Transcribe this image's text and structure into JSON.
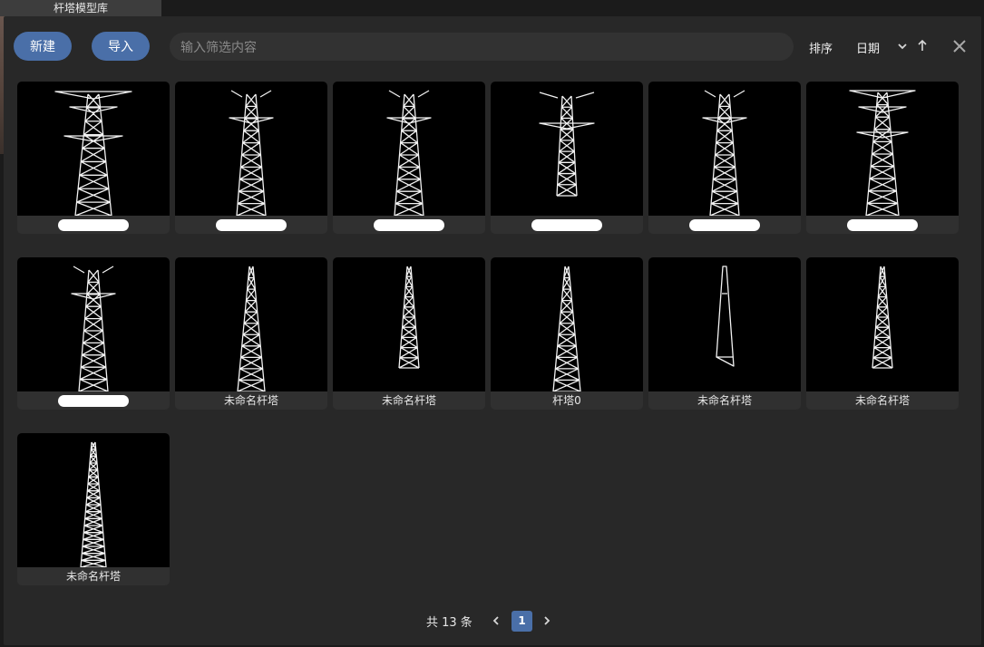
{
  "window": {
    "title": "杆塔模型库"
  },
  "toolbar": {
    "new_label": "新建",
    "import_label": "导入",
    "search_placeholder": "输入筛选内容",
    "sort_label": "排序",
    "sort_field": "日期",
    "chevron_icon": "chevron-down-icon",
    "direction_icon": "arrow-up-icon",
    "close_icon": "close-icon"
  },
  "accent_color": "#4a6fa8",
  "models": [
    {
      "label": "",
      "type": "double-crossarm",
      "redacted": true
    },
    {
      "label": "",
      "type": "cup-head",
      "redacted": true
    },
    {
      "label": "",
      "type": "cup-head",
      "redacted": true
    },
    {
      "label": "",
      "type": "cup-head-short",
      "redacted": true
    },
    {
      "label": "",
      "type": "cup-head",
      "redacted": true
    },
    {
      "label": "",
      "type": "double-crossarm-wide",
      "redacted": true
    },
    {
      "label": "",
      "type": "cup-head",
      "redacted": true
    },
    {
      "label": "未命名杆塔",
      "type": "lattice-spire",
      "redacted": false
    },
    {
      "label": "未命名杆塔",
      "type": "lattice-spire-short",
      "redacted": false
    },
    {
      "label": "杆塔0",
      "type": "lattice-spire",
      "redacted": false
    },
    {
      "label": "未命名杆塔",
      "type": "slim-pole",
      "redacted": false
    },
    {
      "label": "未命名杆塔",
      "type": "lattice-spire-short",
      "redacted": false
    },
    {
      "label": "未命名杆塔",
      "type": "dense-spire",
      "redacted": false
    }
  ],
  "pagination": {
    "total_text": "共 13 条",
    "current_page": "1",
    "prev_icon": "chevron-left-icon",
    "next_icon": "chevron-right-icon"
  }
}
